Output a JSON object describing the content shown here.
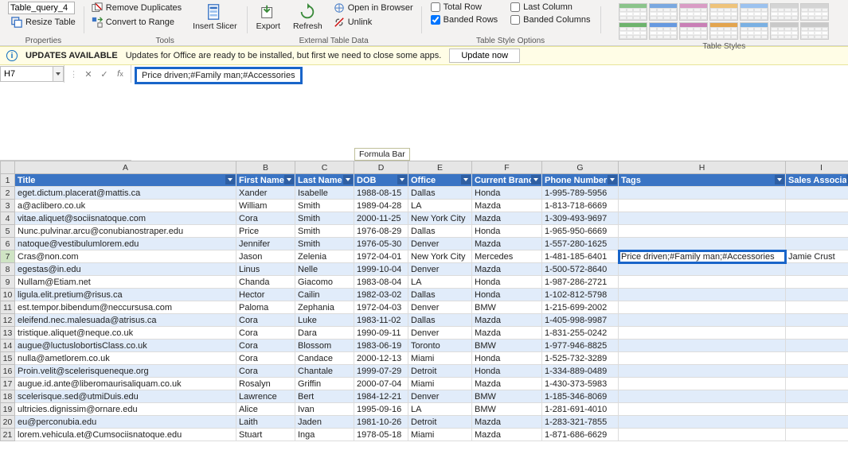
{
  "ribbon": {
    "table_name_input": "Table_query_4",
    "resize_table": "Resize Table",
    "properties_label": "Properties",
    "remove_dup": "Remove Duplicates",
    "convert_range": "Convert to Range",
    "tools_label": "Tools",
    "insert_slicer": "Insert Slicer",
    "export": "Export",
    "refresh": "Refresh",
    "open_browser": "Open in Browser",
    "unlink": "Unlink",
    "external_label": "External Table Data",
    "opts": {
      "total_row": "Total Row",
      "last_col": "Last Column",
      "banded_rows": "Banded Rows",
      "banded_cols": "Banded Columns"
    },
    "style_opts_label": "Table Style Options",
    "styles_label": "Table Styles"
  },
  "update_bar": {
    "title": "UPDATES AVAILABLE",
    "msg": "Updates for Office are ready to be installed, but first we need to close some apps.",
    "btn": "Update now"
  },
  "name_box": "H7",
  "formula_text": "Price driven;#Family man;#Accessories",
  "formula_hint": "Formula Bar",
  "columns": [
    "A",
    "B",
    "C",
    "D",
    "E",
    "F",
    "G",
    "H",
    "I"
  ],
  "headers": [
    "Title",
    "First Name",
    "Last Name",
    "DOB",
    "Office",
    "Current Brand",
    "Phone Number",
    "Tags",
    "Sales Associate"
  ],
  "selected_cell": {
    "row": 7,
    "col": "H"
  },
  "rows": [
    {
      "n": 2,
      "A": "eget.dictum.placerat@mattis.ca",
      "B": "Xander",
      "C": "Isabelle",
      "D": "1988-08-15",
      "E": "Dallas",
      "F": "Honda",
      "G": "1-995-789-5956",
      "H": "",
      "I": ""
    },
    {
      "n": 3,
      "A": "a@aclibero.co.uk",
      "B": "William",
      "C": "Smith",
      "D": "1989-04-28",
      "E": "LA",
      "F": "Mazda",
      "G": "1-813-718-6669",
      "H": "",
      "I": ""
    },
    {
      "n": 4,
      "A": "vitae.aliquet@sociisnatoque.com",
      "B": "Cora",
      "C": "Smith",
      "D": "2000-11-25",
      "E": "New York City",
      "F": "Mazda",
      "G": "1-309-493-9697",
      "H": "",
      "I": ""
    },
    {
      "n": 5,
      "A": "Nunc.pulvinar.arcu@conubianostraper.edu",
      "B": "Price",
      "C": "Smith",
      "D": "1976-08-29",
      "E": "Dallas",
      "F": "Honda",
      "G": "1-965-950-6669",
      "H": "",
      "I": ""
    },
    {
      "n": 6,
      "A": "natoque@vestibulumlorem.edu",
      "B": "Jennifer",
      "C": "Smith",
      "D": "1976-05-30",
      "E": "Denver",
      "F": "Mazda",
      "G": "1-557-280-1625",
      "H": "",
      "I": ""
    },
    {
      "n": 7,
      "A": "Cras@non.com",
      "B": "Jason",
      "C": "Zelenia",
      "D": "1972-04-01",
      "E": "New York City",
      "F": "Mercedes",
      "G": "1-481-185-6401",
      "H": "Price driven;#Family man;#Accessories",
      "I": "Jamie Crust"
    },
    {
      "n": 8,
      "A": "egestas@in.edu",
      "B": "Linus",
      "C": "Nelle",
      "D": "1999-10-04",
      "E": "Denver",
      "F": "Mazda",
      "G": "1-500-572-8640",
      "H": "",
      "I": ""
    },
    {
      "n": 9,
      "A": "Nullam@Etiam.net",
      "B": "Chanda",
      "C": "Giacomo",
      "D": "1983-08-04",
      "E": "LA",
      "F": "Honda",
      "G": "1-987-286-2721",
      "H": "",
      "I": ""
    },
    {
      "n": 10,
      "A": "ligula.elit.pretium@risus.ca",
      "B": "Hector",
      "C": "Cailin",
      "D": "1982-03-02",
      "E": "Dallas",
      "F": "Honda",
      "G": "1-102-812-5798",
      "H": "",
      "I": ""
    },
    {
      "n": 11,
      "A": "est.tempor.bibendum@neccursusa.com",
      "B": "Paloma",
      "C": "Zephania",
      "D": "1972-04-03",
      "E": "Denver",
      "F": "BMW",
      "G": "1-215-699-2002",
      "H": "",
      "I": ""
    },
    {
      "n": 12,
      "A": "eleifend.nec.malesuada@atrisus.ca",
      "B": "Cora",
      "C": "Luke",
      "D": "1983-11-02",
      "E": "Dallas",
      "F": "Mazda",
      "G": "1-405-998-9987",
      "H": "",
      "I": ""
    },
    {
      "n": 13,
      "A": "tristique.aliquet@neque.co.uk",
      "B": "Cora",
      "C": "Dara",
      "D": "1990-09-11",
      "E": "Denver",
      "F": "Mazda",
      "G": "1-831-255-0242",
      "H": "",
      "I": ""
    },
    {
      "n": 14,
      "A": "augue@luctuslobortisClass.co.uk",
      "B": "Cora",
      "C": "Blossom",
      "D": "1983-06-19",
      "E": "Toronto",
      "F": "BMW",
      "G": "1-977-946-8825",
      "H": "",
      "I": ""
    },
    {
      "n": 15,
      "A": "nulla@ametlorem.co.uk",
      "B": "Cora",
      "C": "Candace",
      "D": "2000-12-13",
      "E": "Miami",
      "F": "Honda",
      "G": "1-525-732-3289",
      "H": "",
      "I": ""
    },
    {
      "n": 16,
      "A": "Proin.velit@scelerisqueneque.org",
      "B": "Cora",
      "C": "Chantale",
      "D": "1999-07-29",
      "E": "Detroit",
      "F": "Honda",
      "G": "1-334-889-0489",
      "H": "",
      "I": ""
    },
    {
      "n": 17,
      "A": "augue.id.ante@liberomaurisaliquam.co.uk",
      "B": "Rosalyn",
      "C": "Griffin",
      "D": "2000-07-04",
      "E": "Miami",
      "F": "Mazda",
      "G": "1-430-373-5983",
      "H": "",
      "I": ""
    },
    {
      "n": 18,
      "A": "scelerisque.sed@utmiDuis.edu",
      "B": "Lawrence",
      "C": "Bert",
      "D": "1984-12-21",
      "E": "Denver",
      "F": "BMW",
      "G": "1-185-346-8069",
      "H": "",
      "I": ""
    },
    {
      "n": 19,
      "A": "ultricies.dignissim@ornare.edu",
      "B": "Alice",
      "C": "Ivan",
      "D": "1995-09-16",
      "E": "LA",
      "F": "BMW",
      "G": "1-281-691-4010",
      "H": "",
      "I": ""
    },
    {
      "n": 20,
      "A": "eu@perconubia.edu",
      "B": "Laith",
      "C": "Jaden",
      "D": "1981-10-26",
      "E": "Detroit",
      "F": "Mazda",
      "G": "1-283-321-7855",
      "H": "",
      "I": ""
    },
    {
      "n": 21,
      "A": "lorem.vehicula.et@Cumsociisnatoque.edu",
      "B": "Stuart",
      "C": "Inga",
      "D": "1978-05-18",
      "E": "Miami",
      "F": "Mazda",
      "G": "1-871-686-6629",
      "H": "",
      "I": ""
    }
  ],
  "style_colors": [
    "#8bc48b",
    "#7aa8e0",
    "#d99cc5",
    "#efc37a",
    "#9cc2ef",
    "#d4d4d4",
    "#d4d4d4",
    "#6db36d",
    "#6699e0",
    "#c97fb6",
    "#e3a44e",
    "#7ab0e3",
    "#c9c9c9",
    "#c9c9c9"
  ]
}
